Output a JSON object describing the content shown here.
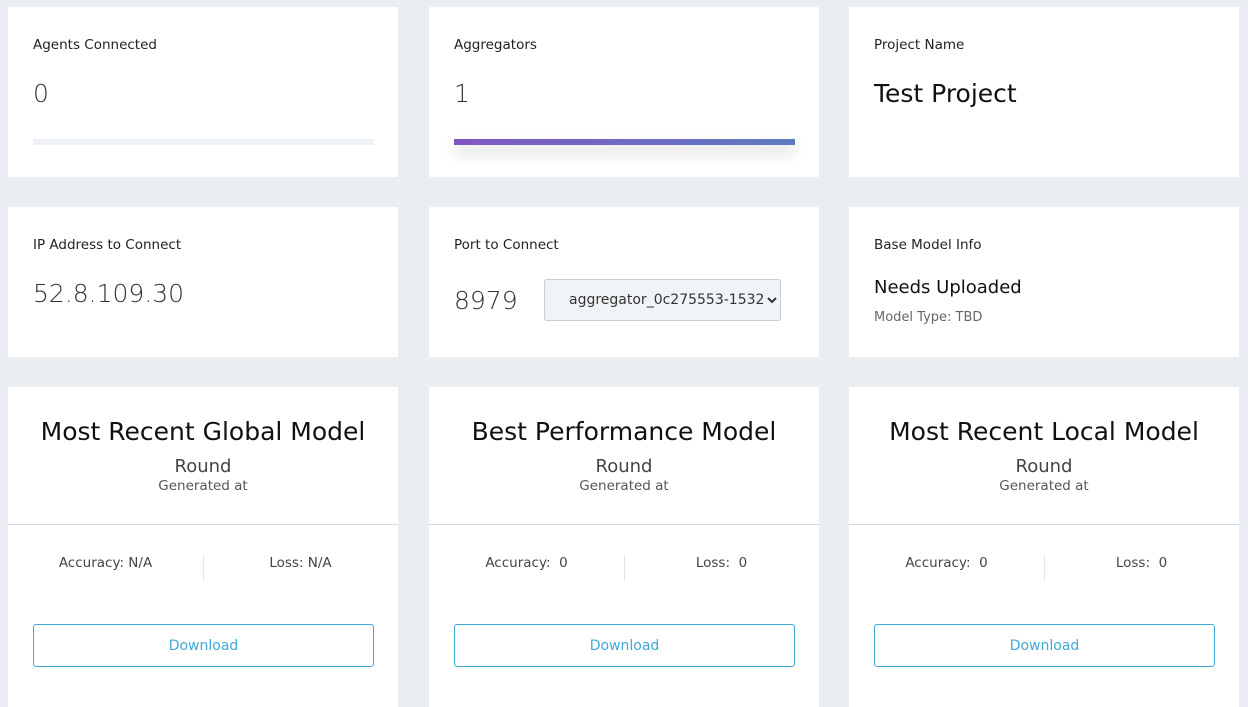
{
  "agents": {
    "label": "Agents Connected",
    "value": "0",
    "progress": 0
  },
  "aggregators": {
    "label": "Aggregators",
    "value": "1",
    "progress": 1.0,
    "bar_colors": [
      "#8057c4",
      "#5e7bc0"
    ]
  },
  "project": {
    "label": "Project Name",
    "value": "Test Project"
  },
  "ip": {
    "label": "IP Address to Connect",
    "value": "52.8.109.30"
  },
  "port": {
    "label": "Port to Connect",
    "value": "8979",
    "select_value": "aggregator_0c275553-1532"
  },
  "base_model": {
    "label": "Base Model Info",
    "status": "Needs Uploaded",
    "model_type": "Model Type: TBD"
  },
  "models": [
    {
      "title": "Most Recent Global Model",
      "round": "Round",
      "generated": "Generated at",
      "accuracy": "Accuracy: N/A",
      "loss": "Loss: N/A",
      "button": "Download"
    },
    {
      "title": "Best Performance Model",
      "round": "Round",
      "generated": "Generated at",
      "accuracy": "Accuracy:  0",
      "loss": "Loss:  0",
      "button": "Download"
    },
    {
      "title": "Most Recent Local Model",
      "round": "Round",
      "generated": "Generated at",
      "accuracy": "Accuracy:  0",
      "loss": "Loss:  0",
      "button": "Download"
    }
  ],
  "colors": {
    "accent": "#3fa9d8",
    "background": "#eaeef3"
  }
}
